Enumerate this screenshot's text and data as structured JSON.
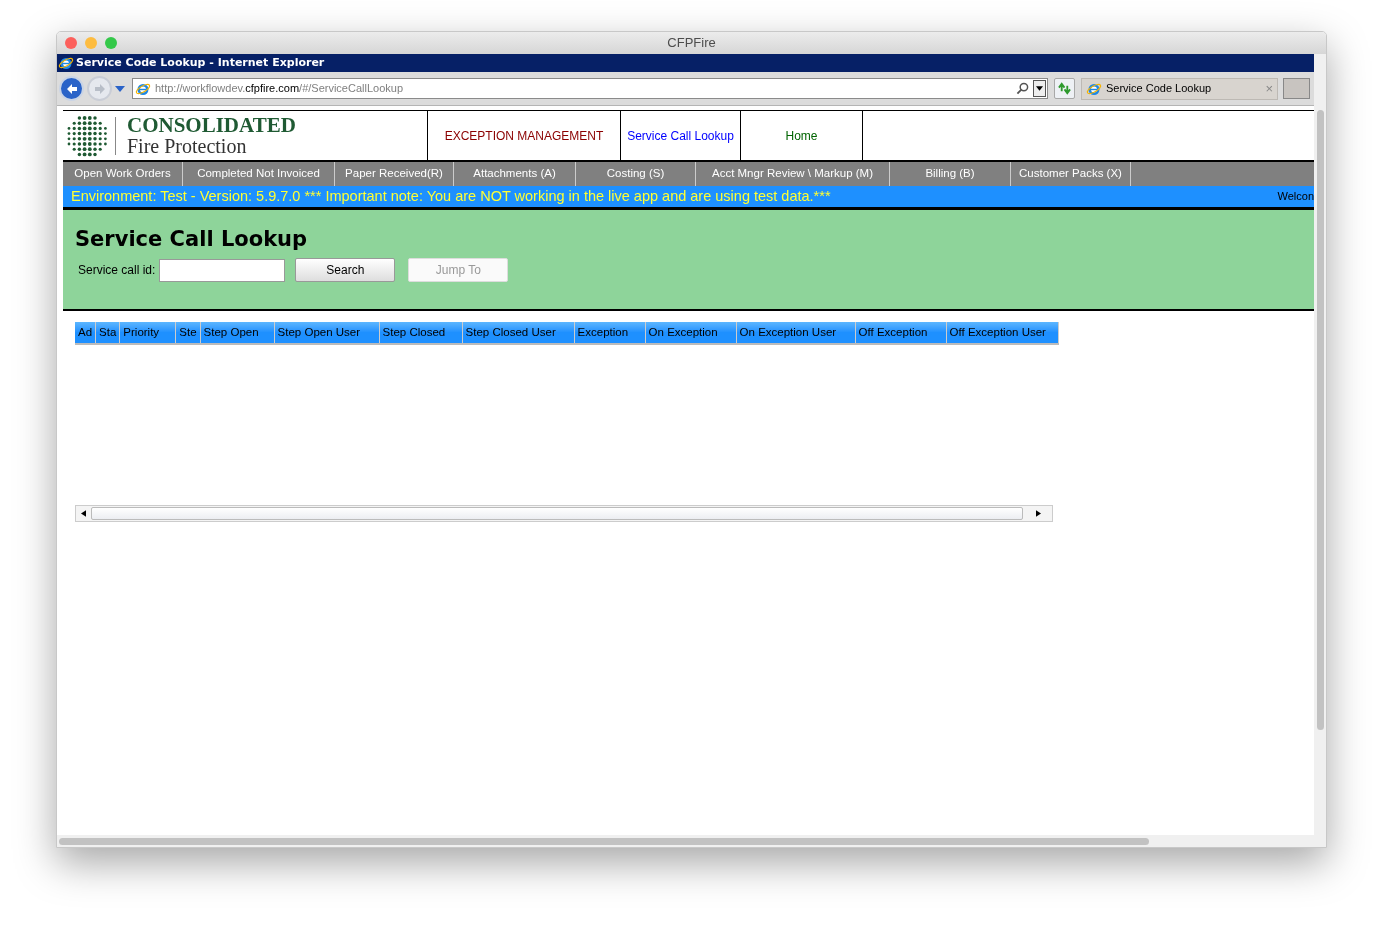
{
  "window": {
    "title": "CFPFire"
  },
  "browser": {
    "title": "Service Code Lookup - Internet Explorer",
    "address": {
      "prefix": "http://workflowdev.",
      "domain": "cfpfire.com",
      "path": "/#/ServiceCallLookup"
    },
    "tab": {
      "label": "Service Code Lookup",
      "close": "×"
    }
  },
  "logo": {
    "line1": "CONSOLIDATED",
    "line2": "Fire Protection"
  },
  "top_nav": [
    {
      "label": "EXCEPTION MANAGEMENT",
      "color": "#8b0000"
    },
    {
      "label": "Service Call Lookup",
      "color": "#0000ff"
    },
    {
      "label": "Home",
      "color": "#006400"
    }
  ],
  "menu": [
    "Open Work Orders",
    "Completed Not Invoiced",
    "Paper Received(R)",
    "Attachments (A)",
    "Costing (S)",
    "Acct Mngr Review \\ Markup (M)",
    "Billing (B)",
    "Customer Packs (X)"
  ],
  "env_banner": {
    "message": "Environment: Test - Version: 5.9.7.0 *** Important note: You are NOT working in the live app and are using test data.***",
    "welcome": "Welcon"
  },
  "page_title": "Service Call Lookup",
  "search": {
    "label": "Service call id:",
    "buttons": [
      {
        "label": "Search",
        "disabled": false
      },
      {
        "label": "Jump To",
        "disabled": true
      }
    ]
  },
  "table": {
    "columns": [
      "Ad",
      "Sta",
      "Priority",
      "Ste",
      "Step Open",
      "Step Open User",
      "Step Closed",
      "Step Closed User",
      "Exception",
      "On Exception",
      "On Exception User",
      "Off Exception",
      "Off Exception User"
    ]
  }
}
